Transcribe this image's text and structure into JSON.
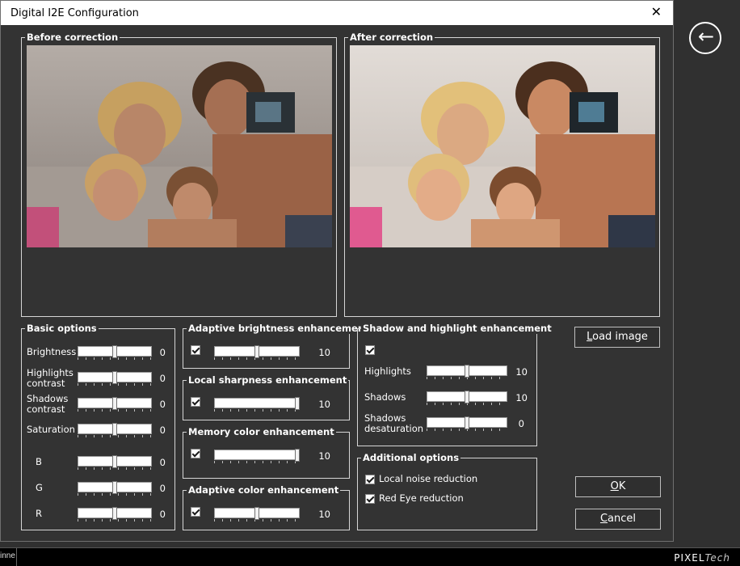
{
  "window": {
    "title": "Digital I2E Configuration",
    "close_glyph": "✕"
  },
  "before": {
    "legend": "Before correction"
  },
  "after": {
    "legend": "After correction"
  },
  "basic": {
    "legend": "Basic options",
    "sliders": [
      {
        "label": "Brightness",
        "value": "0",
        "pos": 0.5
      },
      {
        "label": "Highlights\ncontrast",
        "value": "0",
        "pos": 0.5
      },
      {
        "label": "Shadows\ncontrast",
        "value": "0",
        "pos": 0.5
      },
      {
        "label": "Saturation",
        "value": "0",
        "pos": 0.5
      },
      {
        "label": "B",
        "value": "0",
        "pos": 0.5
      },
      {
        "label": "G",
        "value": "0",
        "pos": 0.5
      },
      {
        "label": "R",
        "value": "0",
        "pos": 0.5
      }
    ]
  },
  "adaptive_brightness": {
    "legend": "Adaptive brightness enhancement",
    "checked": true,
    "value": "10",
    "pos": 0.5
  },
  "local_sharpness": {
    "legend": "Local sharpness enhancement",
    "checked": true,
    "value": "10",
    "pos": 1.0
  },
  "memory_color": {
    "legend": "Memory color enhancement",
    "checked": true,
    "value": "10",
    "pos": 1.0
  },
  "adaptive_color": {
    "legend": "Adaptive color enhancement",
    "checked": true,
    "value": "10",
    "pos": 0.5
  },
  "shadow_highlight": {
    "legend": "Shadow and highlight enhancement",
    "checked": true,
    "sliders": [
      {
        "label": "Highlights",
        "value": "10",
        "pos": 0.5
      },
      {
        "label": "Shadows",
        "value": "10",
        "pos": 0.5
      },
      {
        "label": "Shadows\ndesaturation",
        "value": "0",
        "pos": 0.5
      }
    ]
  },
  "additional": {
    "legend": "Additional options",
    "options": [
      {
        "label": "Local noise reduction",
        "checked": true
      },
      {
        "label": "Red Eye reduction",
        "checked": true
      }
    ]
  },
  "buttons": {
    "load_image_u": "L",
    "load_image_rest": "oad image",
    "ok_u": "O",
    "ok_rest": "K",
    "cancel_u": "C",
    "cancel_rest": "ancel"
  },
  "back": {
    "glyph": "←"
  },
  "footer": {
    "stub": "inne",
    "brand_a": "PIXEL",
    "brand_b": "Tech"
  }
}
